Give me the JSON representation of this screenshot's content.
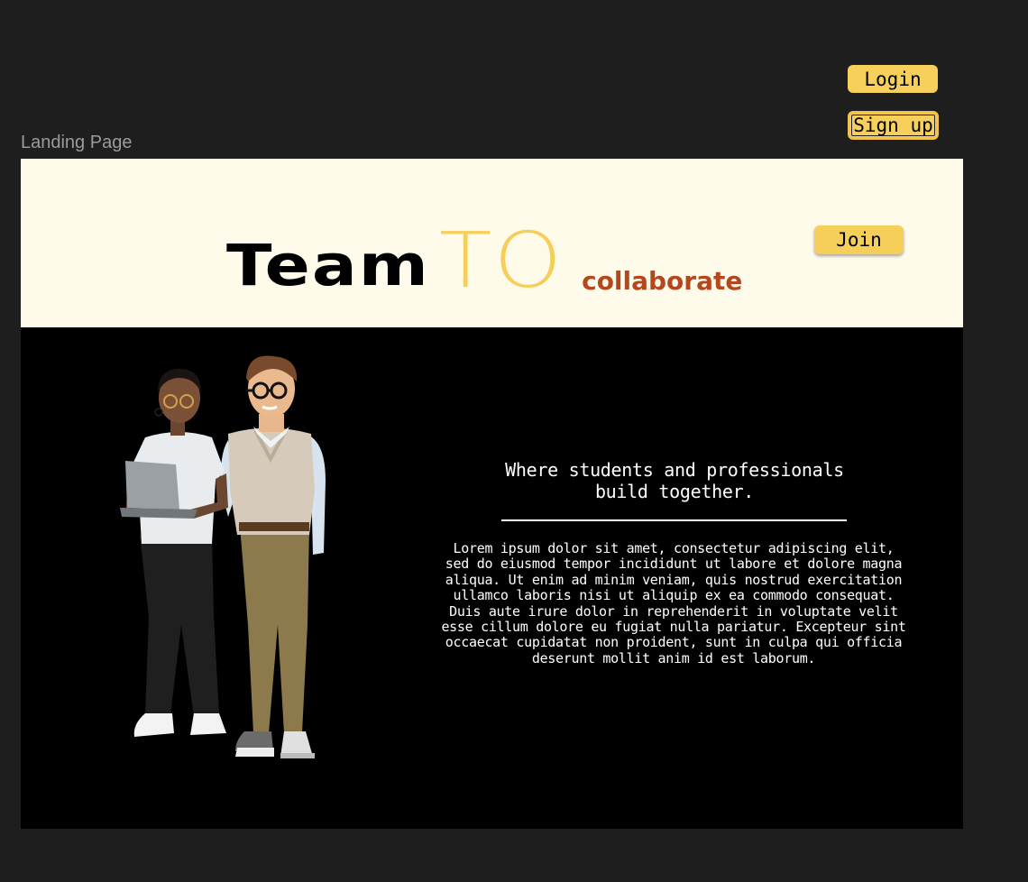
{
  "auth": {
    "login_label": "Login",
    "signup_label": "Sign up"
  },
  "frame": {
    "label": "Landing Page"
  },
  "header": {
    "brand_team": "Team",
    "brand_to": "TO",
    "brand_tagline": "collaborate",
    "join_label": "Join"
  },
  "hero": {
    "tagline_line1": "Where students and professionals",
    "tagline_line2": "build together.",
    "lorem": "Lorem ipsum dolor sit amet, consectetur adipiscing elit, sed do eiusmod tempor incididunt ut labore et dolore magna aliqua. Ut enim ad minim veniam, quis nostrud exercitation ullamco laboris nisi ut aliquip ex ea commodo consequat. Duis aute irure dolor in reprehenderit in voluptate velit esse cillum dolore eu fugiat nulla pariatur. Excepteur sint occaecat cupidatat non proident, sunt in culpa qui officia deserunt mollit anim id est laborum."
  },
  "colors": {
    "canvas_bg": "#1e1e1e",
    "accent_yellow": "#f6cf5b",
    "header_bg": "#fffbeb",
    "brand_orange": "#b5471f",
    "body_bg": "#000000"
  }
}
